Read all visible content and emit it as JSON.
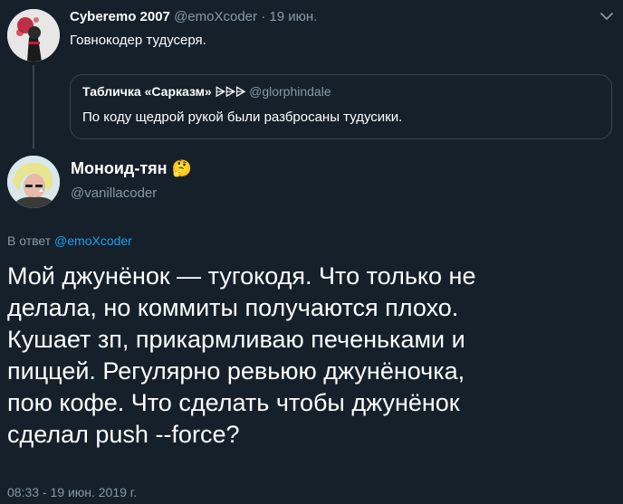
{
  "tweet1": {
    "display_name": "Cyberemo 2007",
    "handle": "@emoXcoder",
    "separator": "·",
    "date": "19 июн.",
    "text": "Говнокодер тудусеря."
  },
  "quote": {
    "display_name": "Табличка «Сарказм» ⩥⩥⩥",
    "handle": "@glorphindale",
    "text": "По коду щедрой рукой были разбросаны тудусики."
  },
  "tweet2": {
    "display_name": "Моноид-тян",
    "emoji": "🤔",
    "handle": "@vanillacoder",
    "reply_prefix": "В ответ",
    "reply_to": "@emoXcoder",
    "text_lines": [
      "Мой джунёнок — тугокодя. Что только не",
      "делала, но коммиты получаются плохо.",
      "Кушает зп, прикармливаю печеньками и",
      "пиццей. Регулярно ревьюю джунёночка,",
      "пою кофе. Что сделать чтобы джунёнок",
      "сделал push --force?"
    ],
    "timestamp": "08:33 - 19 июн. 2019 г."
  },
  "colors": {
    "background": "#15202b",
    "muted": "#8899a6",
    "link": "#1da1f2",
    "border": "#38444d"
  }
}
